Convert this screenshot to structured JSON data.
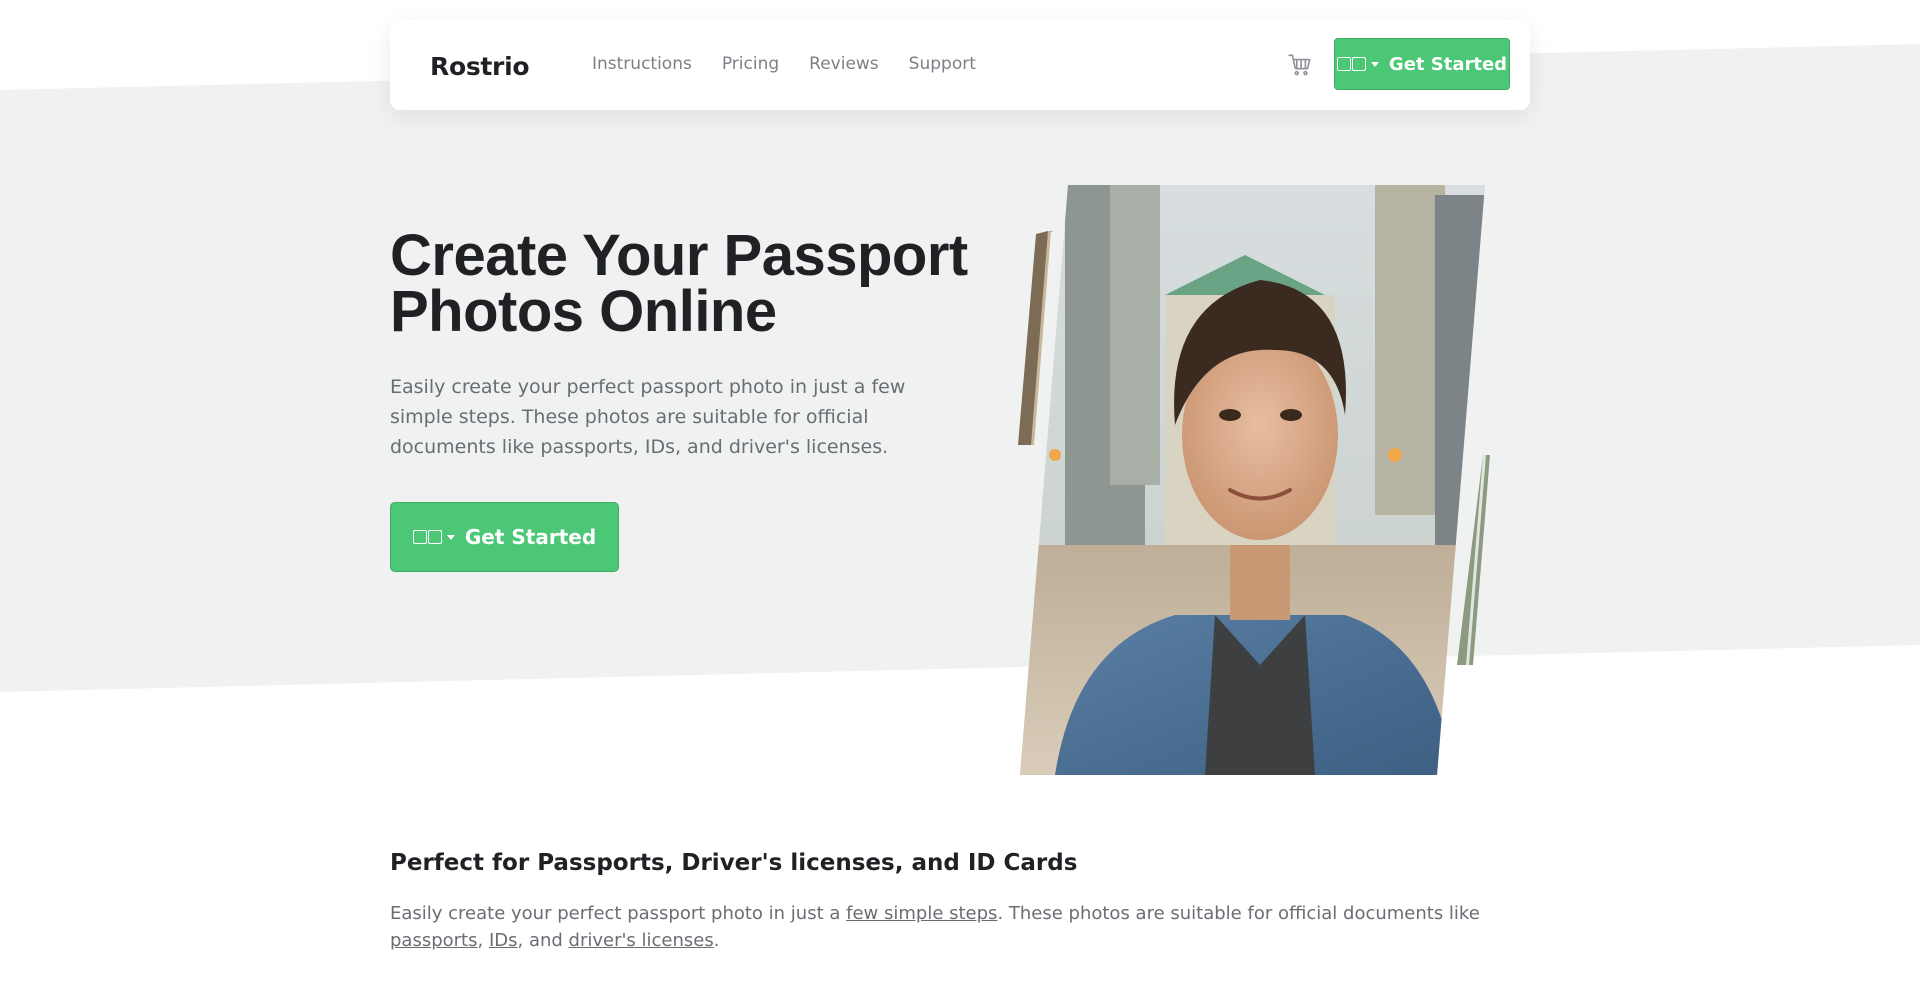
{
  "nav": {
    "brand": "Rostrio",
    "links": [
      "Instructions",
      "Pricing",
      "Reviews",
      "Support"
    ],
    "cta_label": "Get Started"
  },
  "hero": {
    "title": "Create Your Passport Photos Online",
    "subtitle": "Easily create your perfect passport photo in just a few simple steps. These photos are suitable for official documents like passports, IDs, and driver's licenses.",
    "cta_label": "Get Started"
  },
  "section": {
    "title": "Perfect for Passports, Driver's licenses, and ID Cards",
    "text_1": "Easily create your perfect passport photo in just a ",
    "link_steps": "few simple steps",
    "text_2": ". These photos are suitable for official documents like ",
    "link_passports": "passports",
    "text_3": ", ",
    "link_ids": "IDs",
    "text_4": ", and ",
    "link_licenses": "driver's licenses",
    "text_5": "."
  },
  "icons": {
    "cart": "shopping-cart-icon",
    "language": "language-flag-icon"
  },
  "colors": {
    "accent": "#4bc776",
    "hero_background": "#f0f2f1",
    "heading": "#1f2125",
    "body_text": "#6a6d73"
  }
}
